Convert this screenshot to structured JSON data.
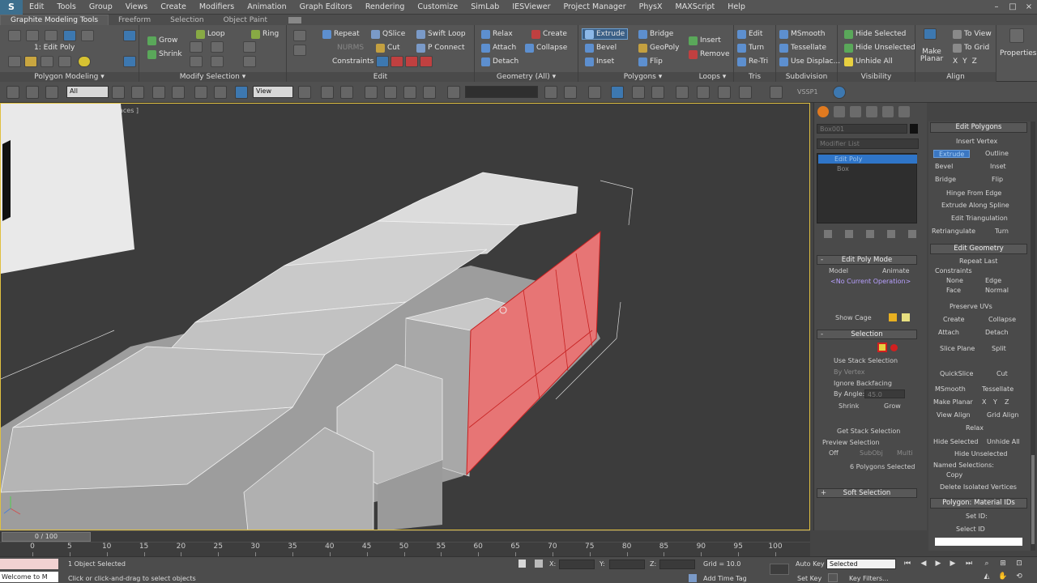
{
  "menu": {
    "items": [
      "Edit",
      "Tools",
      "Group",
      "Views",
      "Create",
      "Modifiers",
      "Animation",
      "Graph Editors",
      "Rendering",
      "Customize",
      "SimLab",
      "IESViewer",
      "Project Manager",
      "PhysX",
      "MAXScript",
      "Help"
    ],
    "window_controls": [
      "–",
      "□",
      "×"
    ]
  },
  "ribbon_tabs": [
    "Graphite Modeling Tools",
    "Freeform",
    "Selection",
    "Object Paint"
  ],
  "ribbon": {
    "polygon_modeling": {
      "title": "Polygon Modeling ▾",
      "stack_label": "1: Edit Poly"
    },
    "modify_selection": {
      "title": "Modify Selection ▾",
      "grow": "Grow",
      "shrink": "Shrink",
      "loop": "Loop",
      "ring": "Ring"
    },
    "edit": {
      "title": "Edit",
      "repeat": "Repeat",
      "qslice": "QSlice",
      "swift_loop": "Swift Loop",
      "nurms": "NURMS",
      "cut": "Cut",
      "p_connect": "P Connect",
      "constraints": "Constraints"
    },
    "geometry": {
      "title": "Geometry (All) ▾",
      "relax": "Relax",
      "create": "Create",
      "attach": "Attach",
      "collapse": "Collapse",
      "detach": "Detach"
    },
    "polygons": {
      "title": "Polygons ▾",
      "extrude": "Extrude",
      "bridge": "Bridge",
      "bevel": "Bevel",
      "geopoly": "GeoPoly",
      "inset": "Inset",
      "flip": "Flip",
      "insert": "Insert",
      "remove": "Remove"
    },
    "loops": {
      "title": "Loops ▾"
    },
    "tris": {
      "title": "Tris",
      "edit": "Edit",
      "turn": "Turn",
      "retri": "Re-Tri"
    },
    "subdivision": {
      "title": "Subdivision",
      "msmooth": "MSmooth",
      "tessellate": "Tessellate",
      "use_displace": "Use Displac..."
    },
    "visibility": {
      "title": "Visibility",
      "hide_selected": "Hide Selected",
      "hide_unselected": "Hide Unselected",
      "unhide_all": "Unhide All"
    },
    "align": {
      "title": "Align",
      "make_planar": "Make Planar",
      "to_view": "To View",
      "to_grid": "To Grid",
      "xyz": [
        "X",
        "Y",
        "Z"
      ]
    },
    "properties": "Properties"
  },
  "toolbar": {
    "selection_filter": "All",
    "ref_coord": "View",
    "named_set": "",
    "snap_label": "VSSP1"
  },
  "viewport": {
    "label": "aces ]"
  },
  "command_panel": {
    "object_name": "Box001",
    "modifier_list": "Modifier List",
    "stack_item": "Edit Poly",
    "stack_sub": "Box",
    "edit_poly_mode": {
      "title": "Edit Poly Mode",
      "model": "Model",
      "animate": "Animate",
      "current_op": "<No Current Operation>",
      "show_cage": "Show Cage"
    },
    "selection": {
      "title": "Selection",
      "use_stack": "Use Stack Selection",
      "by_vertex": "By Vertex",
      "ignore_backfacing": "Ignore Backfacing",
      "by_angle": "By Angle:",
      "angle_value": "45.0",
      "shrink": "Shrink",
      "grow": "Grow",
      "get_stack": "Get Stack Selection",
      "preview_selection": "Preview Selection",
      "off": "Off",
      "subobj": "SubObj",
      "multi": "Multi",
      "status": "6 Polygons Selected"
    },
    "soft_selection": {
      "title": "Soft Selection"
    }
  },
  "edit_panel": {
    "edit_polygons": {
      "title": "Edit Polygons",
      "insert_vertex": "Insert Vertex",
      "extrude": "Extrude",
      "outline": "Outline",
      "bevel": "Bevel",
      "inset": "Inset",
      "bridge": "Bridge",
      "flip": "Flip",
      "hinge": "Hinge From Edge",
      "extrude_spline": "Extrude Along Spline",
      "edit_tri": "Edit Triangulation",
      "retriangulate": "Retriangulate",
      "turn": "Turn"
    },
    "edit_geometry": {
      "title": "Edit Geometry",
      "repeat_last": "Repeat Last",
      "constraints": "Constraints",
      "none": "None",
      "edge": "Edge",
      "face": "Face",
      "normal": "Normal",
      "preserve_uvs": "Preserve UVs",
      "create": "Create",
      "collapse": "Collapse",
      "attach": "Attach",
      "detach": "Detach",
      "slice_plane": "Slice Plane",
      "split": "Split",
      "quickslice": "QuickSlice",
      "cut": "Cut",
      "msmooth": "MSmooth",
      "tessellate": "Tessellate",
      "make_planar": "Make Planar",
      "x": "X",
      "y": "Y",
      "z": "Z",
      "view_align": "View Align",
      "grid_align": "Grid Align",
      "relax": "Relax",
      "hide_selected": "Hide Selected",
      "unhide_all": "Unhide All",
      "hide_unselected": "Hide Unselected",
      "named_selections": "Named Selections:",
      "copy": "Copy",
      "delete_isolated": "Delete Isolated Vertices"
    },
    "material_ids": {
      "title": "Polygon: Material IDs",
      "set_id": "Set ID:",
      "select_id": "Select ID"
    }
  },
  "timeline": {
    "frame_label": "0 / 100",
    "ticks": [
      "0",
      "5",
      "10",
      "15",
      "20",
      "25",
      "30",
      "35",
      "40",
      "45",
      "50",
      "55",
      "60",
      "65",
      "70",
      "75",
      "80",
      "85",
      "90",
      "95",
      "100"
    ]
  },
  "status": {
    "script_text": "Welcome to M",
    "selection": "1 Object Selected",
    "prompt": "Click or click-and-drag to select objects",
    "x_label": "X:",
    "y_label": "Y:",
    "z_label": "Z:",
    "grid": "Grid = 10.0",
    "add_time_tag": "Add Time Tag",
    "auto_key": "Auto Key",
    "set_key": "Set Key",
    "key_mode": "Selected",
    "key_filters": "Key Filters..."
  }
}
